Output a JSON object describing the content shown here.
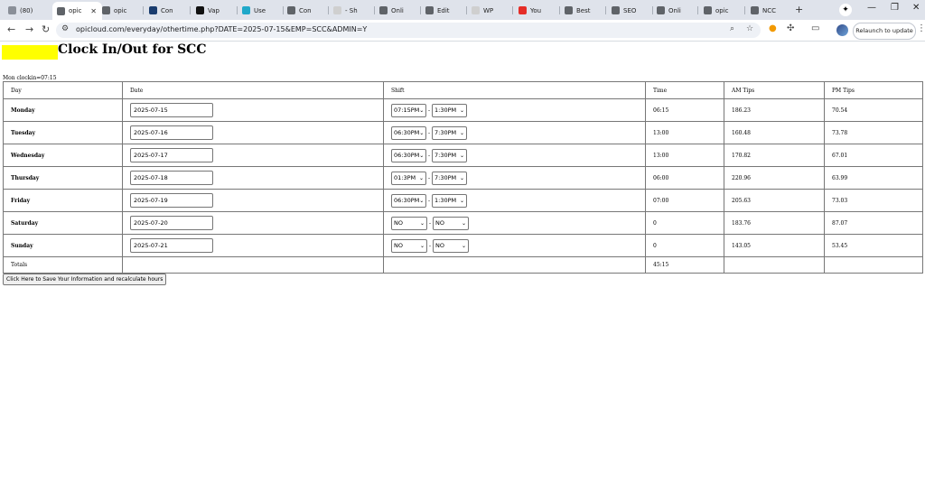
{
  "browser": {
    "tabs": [
      {
        "label": "(80)",
        "color": "#8a8f98"
      },
      {
        "label": "opic",
        "color": "#5f6368",
        "active": true
      },
      {
        "label": "opic",
        "color": "#5f6368"
      },
      {
        "label": "Con",
        "color": "#1a3c6e"
      },
      {
        "label": "Vap",
        "color": "#111111"
      },
      {
        "label": "Use",
        "color": "#1fa8c9"
      },
      {
        "label": "Con",
        "color": "#5f6368"
      },
      {
        "label": "- Sh",
        "color": "#cfcfcf"
      },
      {
        "label": "Onli",
        "color": "#5f6368"
      },
      {
        "label": "Edit",
        "color": "#5f6368"
      },
      {
        "label": "WP",
        "color": "#cfcfcf"
      },
      {
        "label": "You",
        "color": "#e52d27"
      },
      {
        "label": "Best",
        "color": "#5f6368"
      },
      {
        "label": "SEO",
        "color": "#5f6368"
      },
      {
        "label": "Onli",
        "color": "#5f6368"
      },
      {
        "label": "opic",
        "color": "#5f6368"
      },
      {
        "label": "NCC",
        "color": "#5f6368"
      }
    ],
    "new_tab": "+",
    "url": "opicloud.com/everyday/othertime.php?DATE=2025-07-15&EMP=SCC&ADMIN=Y",
    "relaunch_label": "Relaunch to update",
    "window_controls": {
      "minimize": "—",
      "restore": "❐",
      "close": "✕"
    }
  },
  "page": {
    "title": "Clock In/Out for SCC",
    "mon_clockin": "Mon clockin=07:15",
    "headers": [
      "Day",
      "Date",
      "Shift",
      "Time",
      "AM Tips",
      "PM Tips"
    ],
    "rows": [
      {
        "day": "Monday",
        "date": "2025-07-15",
        "shift_in": "07:15PM",
        "shift_out": "1:30PM",
        "time": "06:15",
        "am_tips": "186.23",
        "pm_tips": "70.54"
      },
      {
        "day": "Tuesday",
        "date": "2025-07-16",
        "shift_in": "06:30PM",
        "shift_out": "7:30PM",
        "time": "13:00",
        "am_tips": "160.48",
        "pm_tips": "73.78"
      },
      {
        "day": "Wednesday",
        "date": "2025-07-17",
        "shift_in": "06:30PM",
        "shift_out": "7:30PM",
        "time": "13:00",
        "am_tips": "170.82",
        "pm_tips": "67.01"
      },
      {
        "day": "Thursday",
        "date": "2025-07-18",
        "shift_in": "01:3PM",
        "shift_out": "7:30PM",
        "time": "06:00",
        "am_tips": "220.96",
        "pm_tips": "63.99"
      },
      {
        "day": "Friday",
        "date": "2025-07-19",
        "shift_in": "06:30PM",
        "shift_out": "1:30PM",
        "time": "07:00",
        "am_tips": "205.63",
        "pm_tips": "73.03"
      },
      {
        "day": "Saturday",
        "date": "2025-07-20",
        "shift_in": "NO",
        "shift_out": "NO",
        "time": "0",
        "am_tips": "183.76",
        "pm_tips": "87.07"
      },
      {
        "day": "Sunday",
        "date": "2025-07-21",
        "shift_in": "NO",
        "shift_out": "NO",
        "time": "0",
        "am_tips": "143.05",
        "pm_tips": "53.45"
      }
    ],
    "totals_label": "Totals",
    "totals_time": "45:15",
    "save_button": "Click Here to Save Your Information and recalculate hours"
  }
}
